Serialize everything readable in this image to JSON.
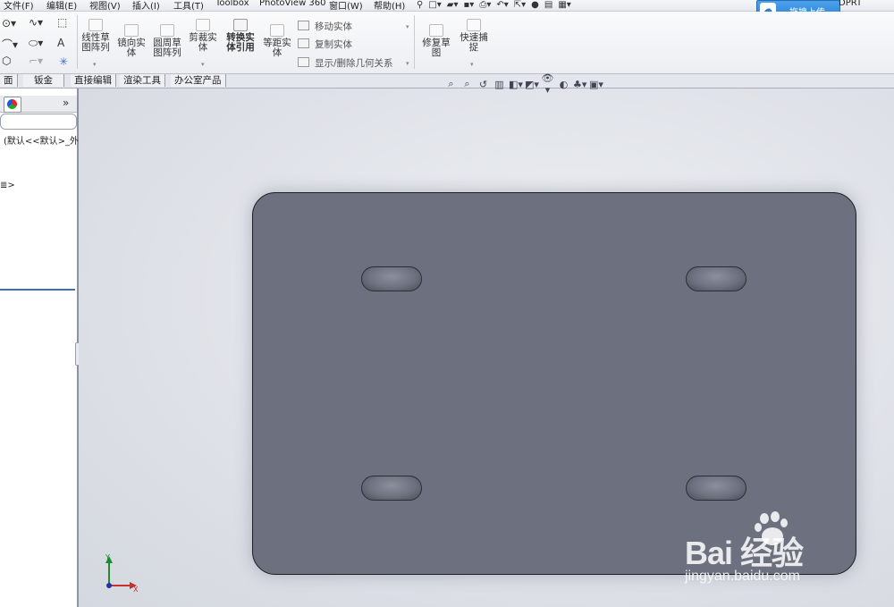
{
  "menubar": {
    "items": [
      "文件(F)",
      "编辑(E)",
      "视图(V)",
      "插入(I)",
      "工具(T)",
      "Toolbox",
      "PhotoView 360",
      "窗口(W)",
      "帮助(H)"
    ],
    "upload_label": "拖拽上传",
    "doc_title": "DPRT"
  },
  "toolbar": {
    "linear_pattern": "线性草\n图阵列",
    "mirror": "镜向实\n体",
    "circular_pattern": "圆周草\n图阵列",
    "trim": "剪裁实\n体",
    "convert": "转换实\n体引用",
    "offset": "等距实\n体",
    "move": "移动实体",
    "copy": "复制实体",
    "relations": "显示/删除几何关系",
    "repair": "修复草\n图",
    "quick_snap": "快速捕\n捉"
  },
  "tabs": [
    "面",
    "钣金",
    "直接编辑",
    "渲染工具",
    "办公室产品"
  ],
  "feature_manager": {
    "expand_glyph": "»",
    "config_text": "(默认<<默认>_外",
    "item2_text": "≣>"
  },
  "triad": {
    "y_label": "Y",
    "x_label": "X"
  },
  "watermark": {
    "logo": "Bai  经验",
    "url": "jingyan.baidu.com"
  },
  "parts": {
    "color": "#6c707f",
    "outline": "#1e2026"
  }
}
